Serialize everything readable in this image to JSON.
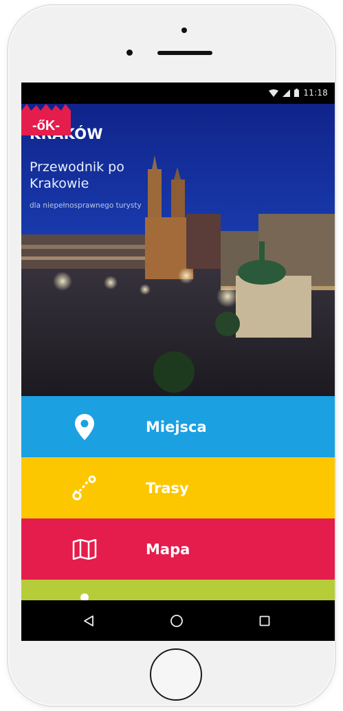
{
  "status_bar": {
    "time": "11:18"
  },
  "hero": {
    "title": "KRAKÓW",
    "subtitle": "Przewodnik po Krakowie",
    "caption": "dla niepełnosprawnego turysty"
  },
  "menu": [
    {
      "label": "Miejsca",
      "icon": "map-pin-icon",
      "color": "#1ba0e2"
    },
    {
      "label": "Trasy",
      "icon": "route-icon",
      "color": "#fdc700"
    },
    {
      "label": "Mapa",
      "icon": "map-icon",
      "color": "#e51d4c"
    },
    {
      "label": "",
      "icon": "info-icon",
      "color": "#b7cc39"
    }
  ],
  "nav": {
    "back_icon": "back-triangle-icon",
    "home_icon": "home-circle-icon",
    "recent_icon": "recent-square-icon"
  },
  "colors": {
    "logo": "#e51d4c",
    "hero_sky": "#0d2e8a"
  }
}
